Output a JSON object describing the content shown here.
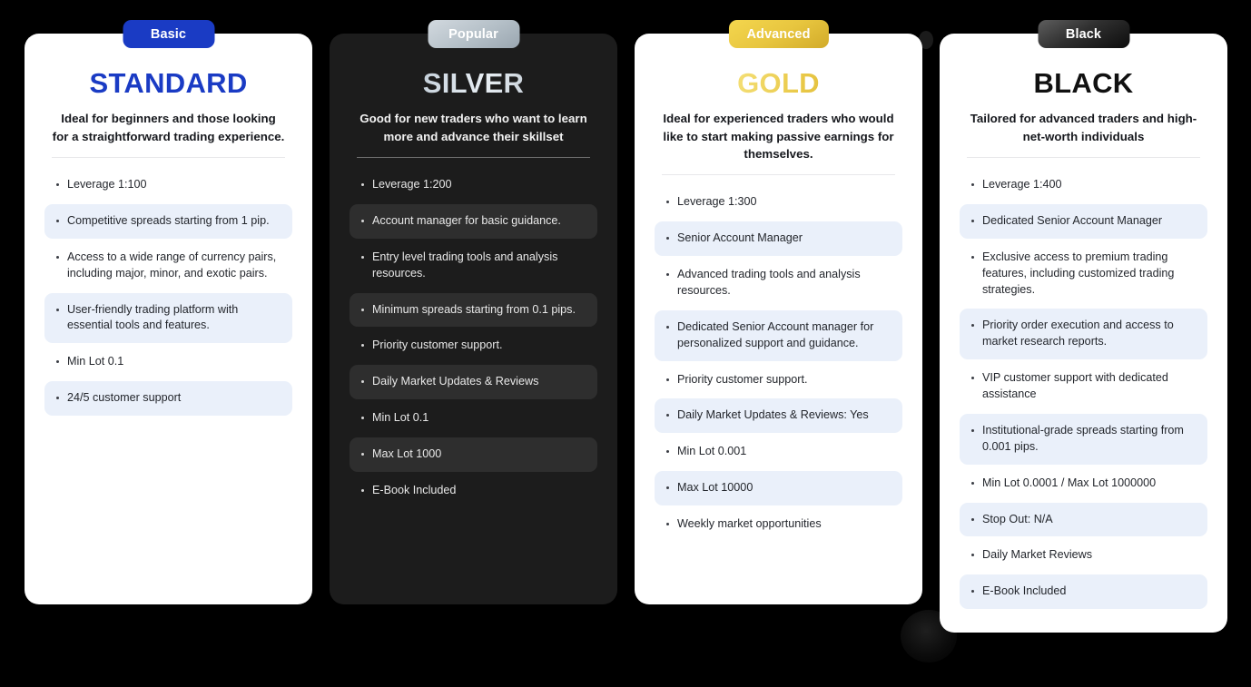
{
  "page": {
    "background": "#000000"
  },
  "plans": [
    {
      "badge": "Basic",
      "badge_style": "basic",
      "title": "STANDARD",
      "title_style": "standard",
      "theme": "light",
      "description": "Ideal for beginners and those looking for a straightforward trading experience.",
      "accent": "#1a3bc4",
      "highlight_color": "#eaf0fa",
      "features": [
        {
          "text": "Leverage 1:100",
          "highlighted": false
        },
        {
          "text": "Competitive spreads starting from 1 pip.",
          "highlighted": true
        },
        {
          "text": "Access to a wide range of currency pairs, including major, minor, and exotic pairs.",
          "highlighted": false
        },
        {
          "text": "User-friendly trading platform with essential tools and features.",
          "highlighted": true
        },
        {
          "text": "Min Lot 0.1",
          "highlighted": false
        },
        {
          "text": "24/5 customer support",
          "highlighted": true
        }
      ]
    },
    {
      "badge": "Popular",
      "badge_style": "popular",
      "title": "SILVER",
      "title_style": "silver",
      "theme": "dark",
      "description": "Good for new traders who want to learn more and advance their skillset",
      "accent": "#c2ccd4",
      "highlight_color": "#2e2e2e",
      "features": [
        {
          "text": "Leverage 1:200",
          "highlighted": false
        },
        {
          "text": "Account manager for basic guidance.",
          "highlighted": true
        },
        {
          "text": "Entry level  trading tools and analysis resources.",
          "highlighted": false
        },
        {
          "text": "Minimum spreads starting from 0.1 pips.",
          "highlighted": true
        },
        {
          "text": "Priority customer support.",
          "highlighted": false
        },
        {
          "text": "Daily Market Updates & Reviews",
          "highlighted": true
        },
        {
          "text": "Min Lot 0.1",
          "highlighted": false
        },
        {
          "text": "Max Lot 1000",
          "highlighted": true
        },
        {
          "text": "E-Book Included",
          "highlighted": false
        }
      ]
    },
    {
      "badge": "Advanced",
      "badge_style": "advanced",
      "title": "GOLD",
      "title_style": "gold",
      "theme": "light",
      "description": "Ideal for experienced traders who would like to start making passive earnings for themselves.",
      "accent": "#e6c341",
      "highlight_color": "#eaf0fa",
      "features": [
        {
          "text": "Leverage 1:300",
          "highlighted": false
        },
        {
          "text": "Senior Account Manager",
          "highlighted": true
        },
        {
          "text": "Advanced trading tools and analysis resources.",
          "highlighted": false
        },
        {
          "text": "Dedicated Senior Account manager for personalized support and guidance.",
          "highlighted": true
        },
        {
          "text": "Priority customer support.",
          "highlighted": false
        },
        {
          "text": "Daily Market Updates & Reviews: Yes",
          "highlighted": true
        },
        {
          "text": "Min Lot 0.001",
          "highlighted": false
        },
        {
          "text": "Max Lot 10000",
          "highlighted": true
        },
        {
          "text": "Weekly market opportunities",
          "highlighted": false
        }
      ]
    },
    {
      "badge": "Black",
      "badge_style": "black",
      "title": "BLACK",
      "title_style": "black",
      "theme": "light",
      "description": "Tailored for advanced traders and high-net-worth individuals",
      "accent": "#111111",
      "highlight_color": "#eaf0fa",
      "features": [
        {
          "text": "Leverage 1:400",
          "highlighted": false
        },
        {
          "text": "Dedicated Senior Account Manager",
          "highlighted": true
        },
        {
          "text": "Exclusive access to premium trading features, including customized trading strategies.",
          "highlighted": false
        },
        {
          "text": "Priority order execution and access to market research reports.",
          "highlighted": true
        },
        {
          "text": "VIP customer support with dedicated assistance",
          "highlighted": false
        },
        {
          "text": "Institutional-grade spreads starting from 0.001 pips.",
          "highlighted": true
        },
        {
          "text": "Min Lot 0.0001 / Max Lot 1000000",
          "highlighted": false
        },
        {
          "text": "Stop Out: N/A",
          "highlighted": true
        },
        {
          "text": "Daily Market Reviews",
          "highlighted": false
        },
        {
          "text": "E-Book Included",
          "highlighted": true
        }
      ]
    }
  ]
}
